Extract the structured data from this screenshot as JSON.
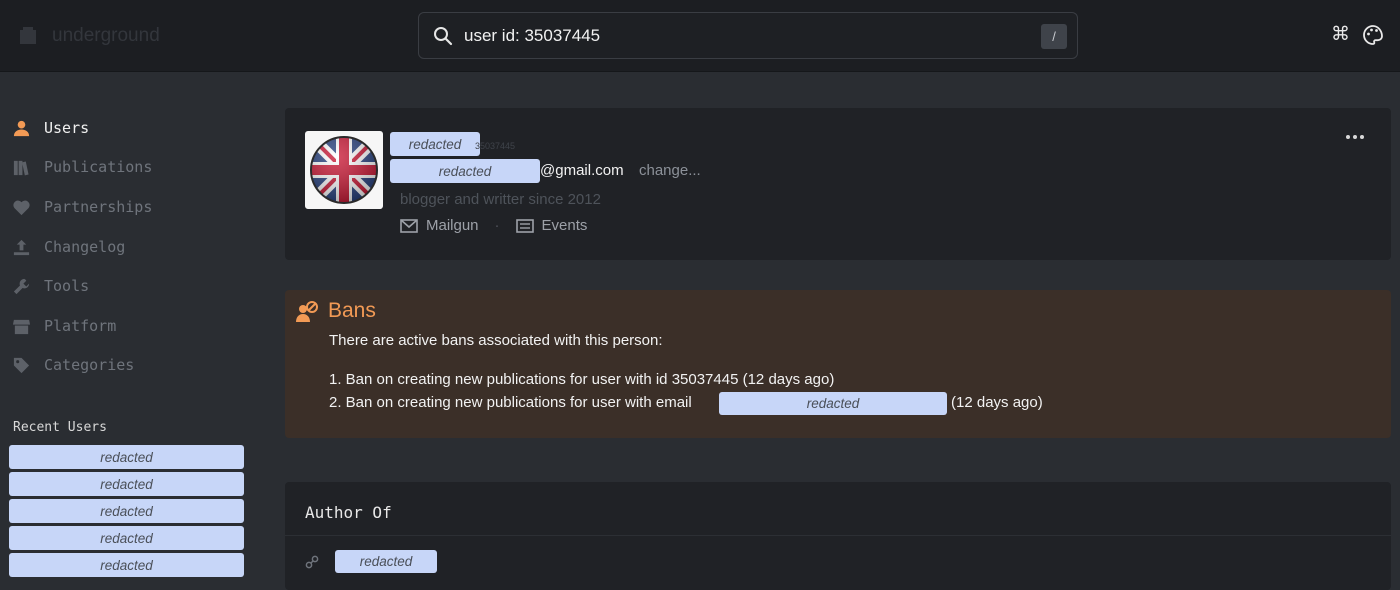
{
  "brand": {
    "name": "underground",
    "icon": "building-icon"
  },
  "search": {
    "value": "user id: 35037445",
    "placeholder": "",
    "shortcut": "/"
  },
  "topbar": {
    "command_icon": "⌘"
  },
  "sidebar": {
    "items": [
      {
        "label": "Users",
        "icon": "user-icon",
        "active": true
      },
      {
        "label": "Publications",
        "icon": "books-icon"
      },
      {
        "label": "Partnerships",
        "icon": "heart-icon"
      },
      {
        "label": "Changelog",
        "icon": "upload-icon"
      },
      {
        "label": "Tools",
        "icon": "wrench-icon"
      },
      {
        "label": "Platform",
        "icon": "store-icon"
      },
      {
        "label": "Categories",
        "icon": "tag-icon"
      }
    ],
    "recent_title": "Recent Users",
    "recent_users": [
      "redacted",
      "redacted",
      "redacted",
      "redacted",
      "redacted"
    ]
  },
  "profile": {
    "name": "redacted",
    "faint_id": "35037445",
    "email_local": "redacted",
    "email_domain": "@gmail.com",
    "change_label": "change...",
    "bio": "blogger and writter since 2012",
    "links": {
      "mailgun": "Mailgun",
      "separator": "·",
      "events": "Events"
    }
  },
  "bans": {
    "title": "Bans",
    "description": "There are active bans associated with this person:",
    "line1": "1. Ban on creating new publications for user with id 35037445 (12 days ago)",
    "line2_prefix": "2. Ban on creating new publications for user with email",
    "line2_redacted": "redacted",
    "line2_suffix": "(12 days ago)"
  },
  "author": {
    "title": "Author Of",
    "publications": [
      "redacted"
    ]
  },
  "colors": {
    "background": "#2a2d32",
    "topbar": "#1c1e22",
    "card": "#202226",
    "bans_card": "#3b2f28",
    "accent": "#f29a55",
    "redaction": "#c7d6f8"
  }
}
